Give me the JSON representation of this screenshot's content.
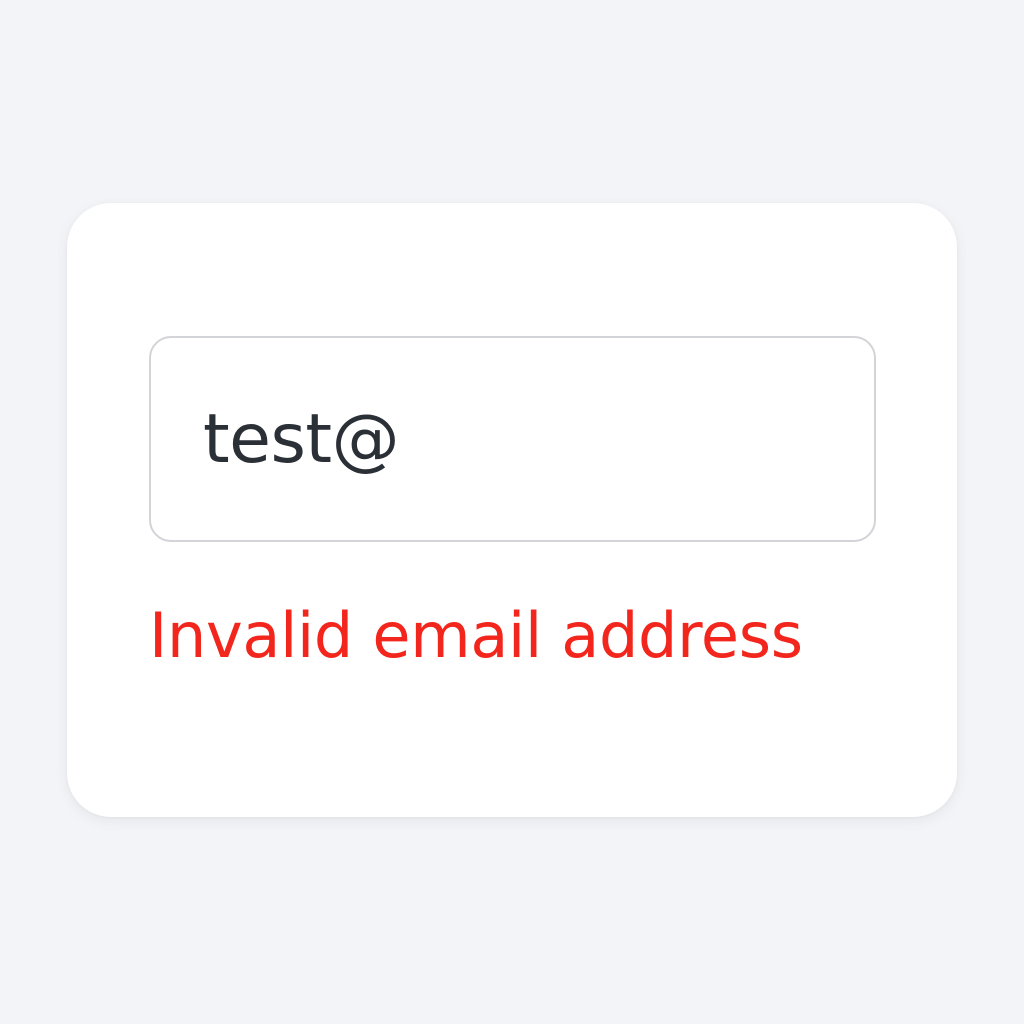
{
  "form": {
    "email_value": "test@",
    "error_message": "Invalid email address"
  },
  "colors": {
    "background": "#f3f4f7",
    "card": "#ffffff",
    "input_border": "#d3d4d8",
    "input_text": "#2b2f36",
    "error": "#f2261c"
  }
}
